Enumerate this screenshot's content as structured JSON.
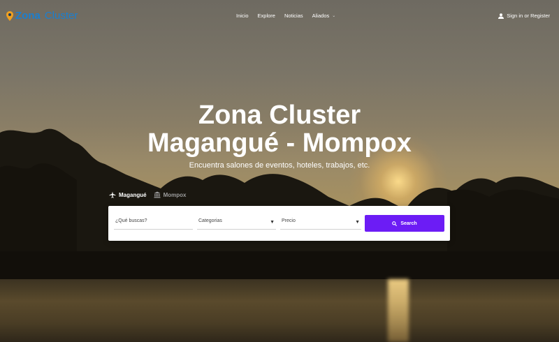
{
  "header": {
    "logo_bold": "Zona",
    "logo_light": "Cluster",
    "nav": [
      {
        "label": "Inicio"
      },
      {
        "label": "Explore"
      },
      {
        "label": "Noticias"
      },
      {
        "label": "Aliados"
      }
    ],
    "signin_label": "Sign in or Register"
  },
  "hero": {
    "title_line1": "Zona Cluster",
    "title_line2": "Magangué - Mompox",
    "subtitle": "Encuentra salones de eventos, hoteles, trabajos, etc."
  },
  "tabs": [
    {
      "label": "Magangué",
      "icon": "airplane-icon",
      "active": true
    },
    {
      "label": "Mompox",
      "icon": "bank-icon",
      "active": false
    }
  ],
  "search": {
    "query_placeholder": "¿Qué buscas?",
    "category_label": "Categorias",
    "price_label": "Precio",
    "button_label": "Search"
  },
  "colors": {
    "brand": "#1a7fd0",
    "accent": "#6c1cf5"
  }
}
